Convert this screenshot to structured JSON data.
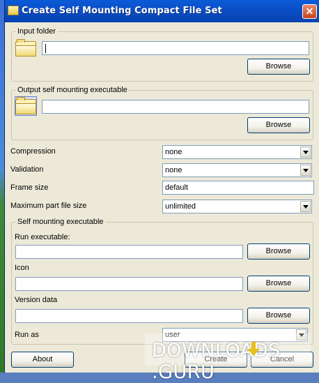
{
  "window": {
    "title": "Create Self Mounting Compact File Set",
    "close_glyph": "✕"
  },
  "input_folder": {
    "label": "Input folder",
    "value": "",
    "browse_label": "Browse"
  },
  "output_exe": {
    "label": "Output self mounting executable",
    "value": "",
    "browse_label": "Browse"
  },
  "options": {
    "compression": {
      "label": "Compression",
      "value": "none"
    },
    "validation": {
      "label": "Validation",
      "value": "none"
    },
    "frame_size": {
      "label": "Frame size",
      "value": "default"
    },
    "max_part_size": {
      "label": "Maximum part file size",
      "value": "unlimited"
    }
  },
  "self_mounting": {
    "label": "Self mounting executable",
    "run_executable": {
      "label": "Run executable:",
      "value": "",
      "browse_label": "Browse"
    },
    "icon": {
      "label": "Icon",
      "value": "",
      "browse_label": "Browse"
    },
    "version_data": {
      "label": "Version data",
      "value": "",
      "browse_label": "Browse"
    },
    "run_as": {
      "label": "Run as",
      "value": "user"
    }
  },
  "footer": {
    "about_label": "About",
    "create_label": "Create",
    "cancel_label": "Cancel"
  },
  "watermark": {
    "left": "DOWNLOADS",
    "right": ".GURU"
  },
  "colors": {
    "title_bar": "#0b4fc8",
    "dialog_bg": "#ece9d8",
    "close": "#c8431f"
  }
}
